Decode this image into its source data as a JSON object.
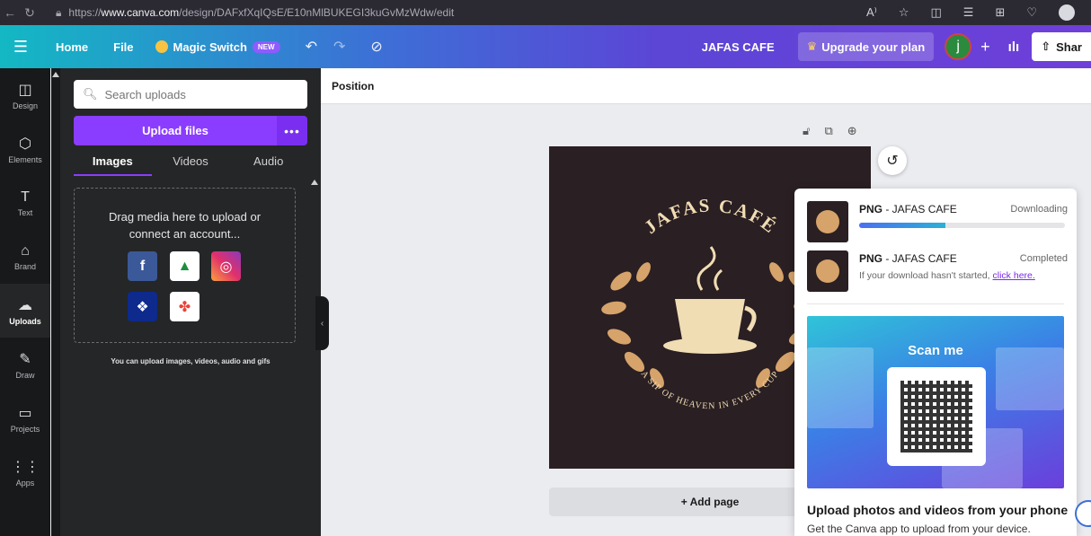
{
  "browser": {
    "url_prefix": "https://",
    "url_domain": "www.canva.com",
    "url_path": "/design/DAFxfXqIQsE/E10nMlBUKEGI3kuGvMzWdw/edit"
  },
  "topbar": {
    "home": "Home",
    "file": "File",
    "magic_switch": "Magic Switch",
    "new_badge": "NEW",
    "design_title": "JAFAS CAFE",
    "upgrade": "Upgrade your plan",
    "user_initial": "j",
    "share": "Shar"
  },
  "rail": {
    "items": [
      {
        "label": "Design",
        "glyph": "◫"
      },
      {
        "label": "Elements",
        "glyph": "⬡"
      },
      {
        "label": "Text",
        "glyph": "T"
      },
      {
        "label": "Brand",
        "glyph": "⌂"
      },
      {
        "label": "Uploads",
        "glyph": "☁"
      },
      {
        "label": "Draw",
        "glyph": "✎"
      },
      {
        "label": "Projects",
        "glyph": "▭"
      },
      {
        "label": "Apps",
        "glyph": "⋮⋮"
      }
    ]
  },
  "panel": {
    "search_placeholder": "Search uploads",
    "upload_button": "Upload files",
    "more": "•••",
    "tabs": [
      "Images",
      "Videos",
      "Audio"
    ],
    "drop_line1": "Drag media here to upload or",
    "drop_line2": "connect an account...",
    "hint": "You can upload images, videos, audio and gifs"
  },
  "context_bar": {
    "position": "Position"
  },
  "canvas": {
    "logo_top_text": "JAFAS CAFÉ",
    "logo_bottom_text": "A SIP OF HEAVEN IN EVERY CUP",
    "add_page": "+ Add page"
  },
  "downloads": {
    "items": [
      {
        "format": "PNG",
        "name": " - JAFAS CAFE",
        "status": "Downloading",
        "progress": 0.42
      },
      {
        "format": "PNG",
        "name": " - JAFAS CAFE",
        "status": "Completed",
        "sub_text": "If your download hasn't started, ",
        "sub_link": "click here."
      }
    ],
    "scan_label": "Scan me",
    "promo_title": "Upload photos and videos from your phone",
    "promo_sub": "Get the Canva app to upload from your device."
  },
  "colors": {
    "accent": "#8b3dff",
    "panel_bg": "#252627",
    "rail_bg": "#18191b",
    "canvas_bg": "#2a1f22",
    "logo_color": "#d6a36a"
  }
}
